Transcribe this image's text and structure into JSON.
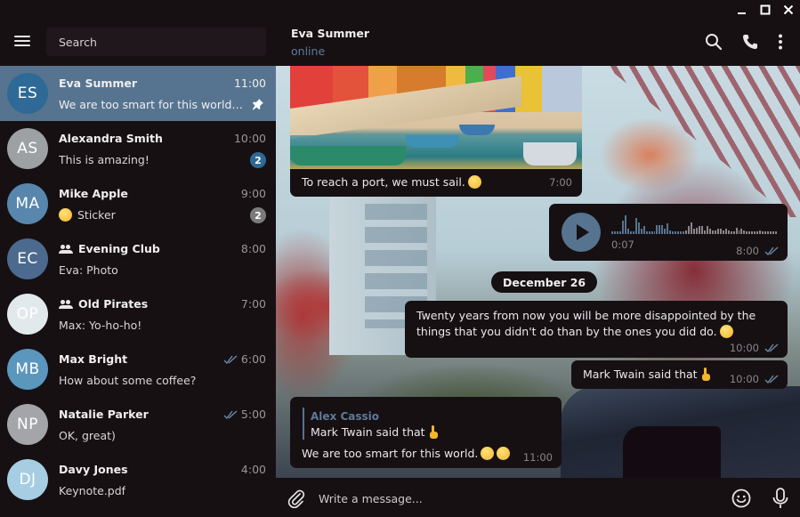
{
  "window": {
    "controls": [
      "minimize",
      "maximize",
      "close"
    ]
  },
  "sidebar": {
    "menu_icon": "hamburger-menu-icon",
    "search_placeholder": "Search",
    "chats": [
      {
        "initials": "ES",
        "name": "Eva Summer",
        "time": "11:00",
        "preview": "We are too smart for this world. 🤣😂",
        "avatar_color": "#2e6a95",
        "active": true,
        "pinned": true,
        "group": false,
        "read_checks": false,
        "unread": null
      },
      {
        "initials": "AS",
        "name": "Alexandra Smith",
        "time": "10:00",
        "preview": "This is amazing!",
        "avatar_color": "#9da1a4",
        "active": false,
        "pinned": false,
        "group": false,
        "read_checks": false,
        "unread": "2",
        "unread_color": "#2e6a95"
      },
      {
        "initials": "MA",
        "name": "Mike Apple",
        "time": "9:00",
        "preview": "Sticker",
        "preview_emoji": true,
        "avatar_color": "#5886ad",
        "active": false,
        "pinned": false,
        "group": false,
        "read_checks": false,
        "unread": "2",
        "unread_color": "#7b7b7b"
      },
      {
        "initials": "EC",
        "name": "Evening Club",
        "time": "8:00",
        "preview": "Eva: Photo",
        "avatar_color": "#4b6a8e",
        "active": false,
        "pinned": false,
        "group": true,
        "read_checks": false,
        "unread": null
      },
      {
        "initials": "OP",
        "name": "Old Pirates",
        "time": "7:00",
        "preview": "Max: Yo-ho-ho!",
        "avatar_color": "#e2e9ec",
        "active": false,
        "pinned": false,
        "group": true,
        "read_checks": false,
        "unread": null
      },
      {
        "initials": "MB",
        "name": "Max Bright",
        "time": "6:00",
        "preview": "How about some coffee?",
        "avatar_color": "#5b96bd",
        "active": false,
        "pinned": false,
        "group": false,
        "read_checks": true,
        "unread": null
      },
      {
        "initials": "NP",
        "name": "Natalie Parker",
        "time": "5:00",
        "preview": "OK, great)",
        "avatar_color": "#a3a5a8",
        "active": false,
        "pinned": false,
        "group": false,
        "read_checks": true,
        "unread": null
      },
      {
        "initials": "DJ",
        "name": "Davy Jones",
        "time": "4:00",
        "preview": "Keynote.pdf",
        "avatar_color": "#a6cde2",
        "active": false,
        "pinned": false,
        "group": false,
        "read_checks": false,
        "unread": null
      }
    ]
  },
  "header": {
    "peer_name": "Eva Summer",
    "peer_status": "online",
    "actions": [
      "search-icon",
      "phone-icon",
      "more-vertical-icon"
    ]
  },
  "messages": {
    "photo": {
      "caption": "To reach a port, we must sail.",
      "emoji": "nerd-face",
      "time": "7:00"
    },
    "voice": {
      "duration": "0:07",
      "time": "8:00",
      "played_fraction": 0.45
    },
    "date_separator": "December 26",
    "quote": {
      "text": "Twenty years from now you will be more disappointed by the things that you didn't do than by the ones you did do.",
      "emoji": "face-with-monocle",
      "time": "10:00"
    },
    "twain": {
      "text": "Mark Twain said that",
      "emoji": "pointing-up",
      "time": "10:00"
    },
    "reply": {
      "author": "Alex Cassio",
      "quoted_text": "Mark Twain said that",
      "text": "We are too smart for this world.",
      "emojis": [
        "rolling-on-floor-laughing",
        "tears-of-joy"
      ],
      "time": "11:00"
    }
  },
  "composer": {
    "placeholder": "Write a message...",
    "attach_icon": "paperclip-icon",
    "emoji_icon": "smiley-icon",
    "mic_icon": "microphone-icon"
  },
  "colors": {
    "accent": "#56748f",
    "background": "#161013",
    "status_online": "#5e7a9a",
    "link_name": "#5e7a9a"
  }
}
